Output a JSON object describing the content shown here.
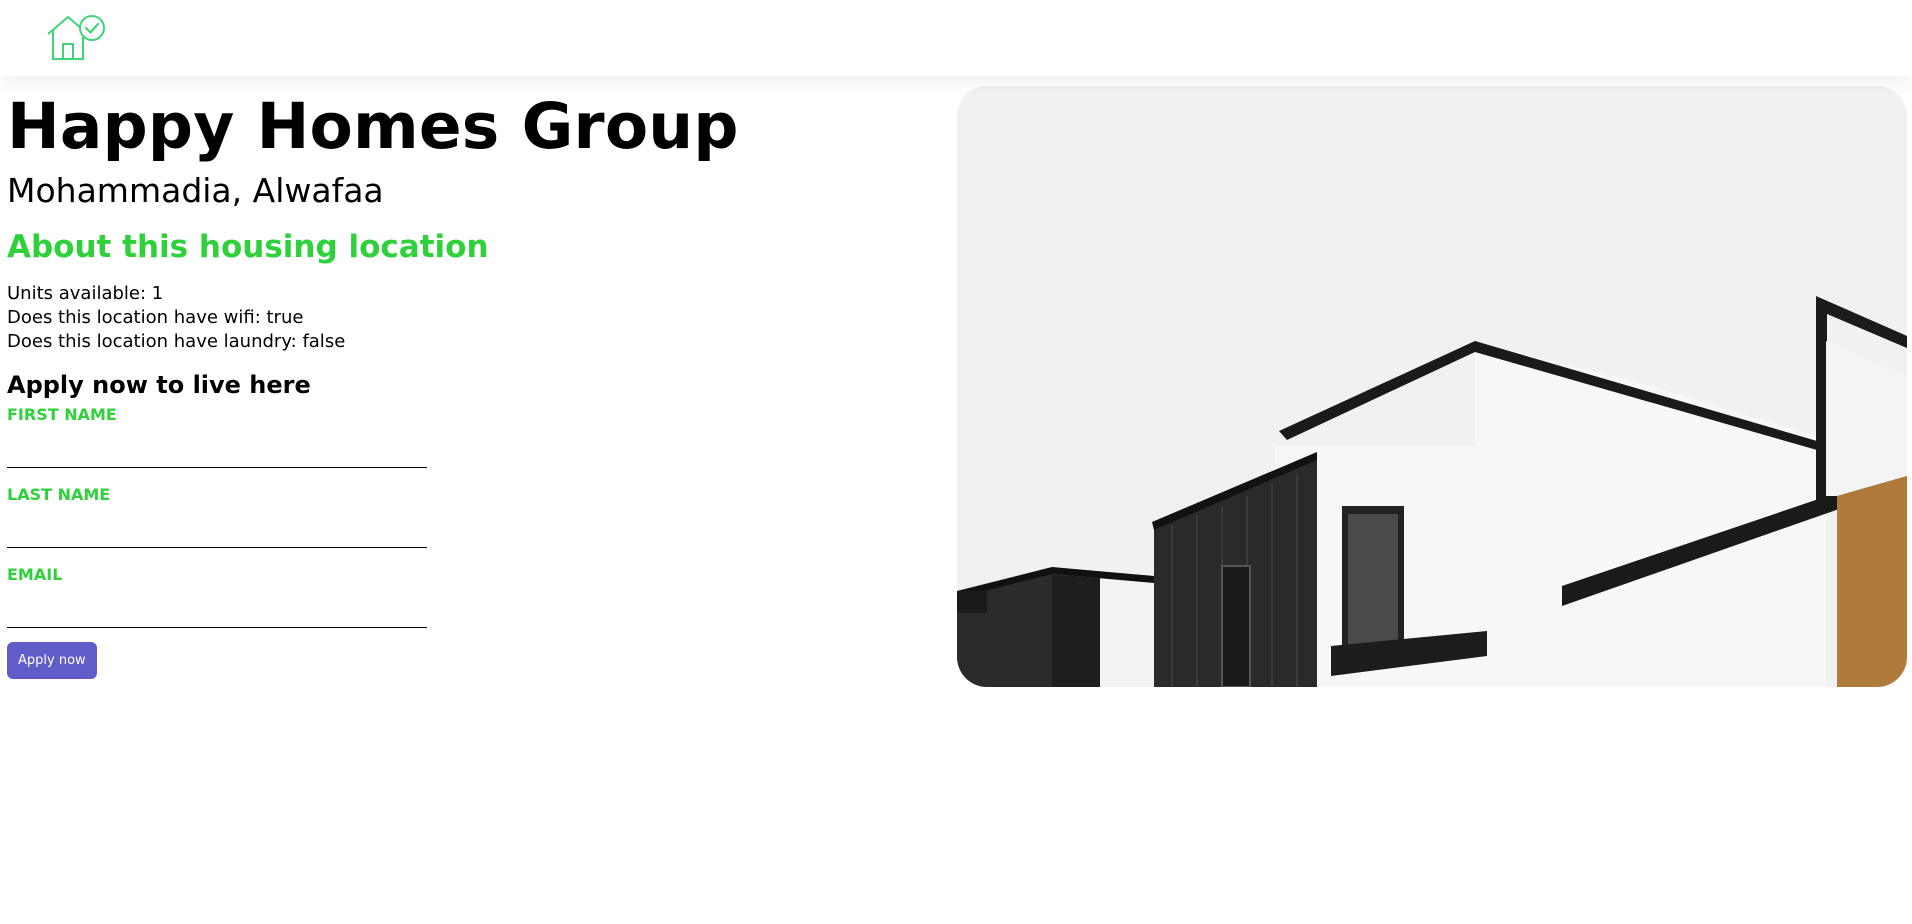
{
  "brand": {
    "logo_icon": "house-check-icon",
    "accent_color": "#2fd13b"
  },
  "listing": {
    "name": "Happy Homes Group",
    "location": "Mohammadia, Alwafaa",
    "about_heading": "About this housing location",
    "features": [
      "Units available: 1",
      "Does this location have wifi: true",
      "Does this location have laundry: false"
    ],
    "photo": "modern-house-exterior-photo"
  },
  "apply": {
    "heading": "Apply now to live here",
    "first_name_label": "FIRST NAME",
    "first_name_value": "",
    "last_name_label": "LAST NAME",
    "last_name_value": "",
    "email_label": "EMAIL",
    "email_value": "",
    "button_label": "Apply now",
    "button_color": "#605dc8"
  }
}
